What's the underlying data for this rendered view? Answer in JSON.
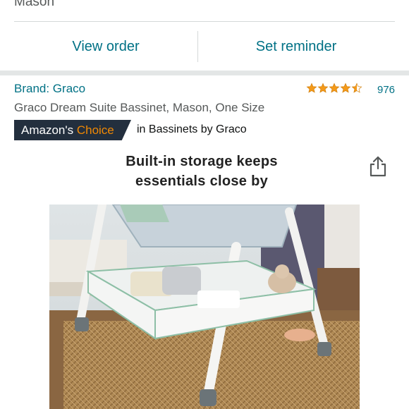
{
  "order": {
    "item_name": "Mason",
    "view_order_label": "View order",
    "set_reminder_label": "Set reminder"
  },
  "product": {
    "brand": "Brand: Graco",
    "rating": 4.5,
    "rating_count": "976",
    "title": "Graco Dream Suite Bassinet, Mason, One Size",
    "badge_prefix": "Amazon's",
    "badge_choice": "Choice",
    "badge_category": "in Bassinets by Graco"
  },
  "image": {
    "headline_line1": "Built-in storage keeps",
    "headline_line2": "essentials close by",
    "share_icon": "share-icon"
  },
  "colors": {
    "link": "#007185",
    "star": "#f49a1a",
    "badge_bg": "#232f3e",
    "badge_accent": "#f08804"
  }
}
